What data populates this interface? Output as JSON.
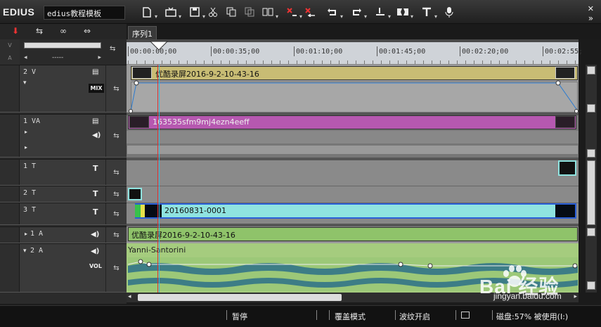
{
  "app": {
    "logo": "EDIUS",
    "project_name": "edius教程模板"
  },
  "toolbar": {
    "icons": [
      "new-file-icon",
      "open-icon",
      "save-icon",
      "cut-icon",
      "copy-icon",
      "paste-icon",
      "paste-insert-icon",
      "delete-icon",
      "ripple-delete-icon",
      "undo-icon",
      "redo-icon",
      "set-in-icon",
      "split-icon",
      "title-icon",
      "voiceover-icon"
    ],
    "more_glyph": "»",
    "close_glyph": "✕"
  },
  "sequence": {
    "tab_label": "序列1",
    "timecodes": [
      "00:00:00;00",
      "00:00:35;00",
      "00:01:10;00",
      "00:01:45;00",
      "00:02:20;00",
      "00:02:55;"
    ]
  },
  "left_panel": {
    "dashes": "-----"
  },
  "tracks": [
    {
      "name": "2 V",
      "clip": "优酷录屏2016-9-2-10-43-16",
      "mix": "MIX"
    },
    {
      "name": "1 VA",
      "clip": "163535sfm9mj4ezn4eeff"
    },
    {
      "name": "1 T"
    },
    {
      "name": "2 T"
    },
    {
      "name": "3 T",
      "clip": "20160831-0001"
    },
    {
      "name": "1 A",
      "clip": "优酷录屏2016-9-2-10-43-16"
    },
    {
      "name": "2 A",
      "clip": "Yanni-Santorini",
      "vol": "VOL"
    }
  ],
  "status": {
    "pause": "暂停",
    "overwrite": "覆盖模式",
    "ripple": "波纹开启",
    "disk": "磁盘:57% 被使用(I:)"
  },
  "watermark": {
    "brand": "Bai 经验",
    "url": "jingyan.baidu.com"
  },
  "colors": {
    "video_clip": "#c8bc74",
    "va_clip": "#b658b0",
    "title_clip": "#8fe3e0",
    "audio_clip": "#8fc36a"
  }
}
